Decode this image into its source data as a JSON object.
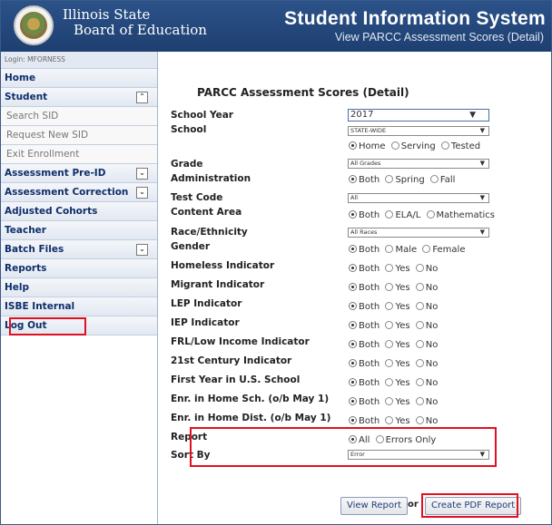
{
  "header": {
    "org_line1": "Illinois State",
    "org_line2": "Board of Education",
    "title": "Student Information System",
    "subtitle": "View PARCC Assessment Scores (Detail)"
  },
  "sidebar": {
    "login": "Login: MFORNESS",
    "items": [
      {
        "label": "Home"
      },
      {
        "label": "Student",
        "chevron": "up"
      },
      {
        "label": "Search SID"
      },
      {
        "label": "Request New SID"
      },
      {
        "label": "Exit Enrollment"
      },
      {
        "label": "Assessment Pre-ID",
        "chevron": "down"
      },
      {
        "label": "Assessment Correction",
        "chevron": "down"
      },
      {
        "label": "Adjusted Cohorts"
      },
      {
        "label": "Teacher"
      },
      {
        "label": "Batch Files",
        "chevron": "down"
      },
      {
        "label": "Reports"
      },
      {
        "label": "Help"
      },
      {
        "label": "ISBE Internal"
      },
      {
        "label": "Log Out"
      }
    ],
    "chevron_up": "⌃",
    "chevron_down": "⌄"
  },
  "main": {
    "section_title": "PARCC Assessment Scores (Detail)",
    "school_year": {
      "label": "School Year",
      "value": "2017"
    },
    "school": {
      "label": "School",
      "value": "STATE-WIDE",
      "options": [
        "Home",
        "Serving",
        "Tested"
      ],
      "selected": "Home"
    },
    "grade": {
      "label": "Grade",
      "value": "All Grades"
    },
    "administration": {
      "label": "Administration",
      "options": [
        "Both",
        "Spring",
        "Fall"
      ],
      "selected": "Both"
    },
    "test_code": {
      "label": "Test Code",
      "value": "All"
    },
    "content_area": {
      "label": "Content Area",
      "options": [
        "Both",
        "ELA/L",
        "Mathematics"
      ],
      "selected": "Both"
    },
    "race": {
      "label": "Race/Ethnicity",
      "value": "All Races"
    },
    "gender": {
      "label": "Gender",
      "options": [
        "Both",
        "Male",
        "Female"
      ],
      "selected": "Both"
    },
    "homeless": {
      "label": "Homeless Indicator",
      "options": [
        "Both",
        "Yes",
        "No"
      ],
      "selected": "Both"
    },
    "migrant": {
      "label": "Migrant Indicator",
      "options": [
        "Both",
        "Yes",
        "No"
      ],
      "selected": "Both"
    },
    "lep": {
      "label": "LEP Indicator",
      "options": [
        "Both",
        "Yes",
        "No"
      ],
      "selected": "Both"
    },
    "iep": {
      "label": "IEP Indicator",
      "options": [
        "Both",
        "Yes",
        "No"
      ],
      "selected": "Both"
    },
    "frl": {
      "label": "FRL/Low Income Indicator",
      "options": [
        "Both",
        "Yes",
        "No"
      ],
      "selected": "Both"
    },
    "century21": {
      "label": "21st Century Indicator",
      "options": [
        "Both",
        "Yes",
        "No"
      ],
      "selected": "Both"
    },
    "first_year": {
      "label": "First Year in U.S. School",
      "options": [
        "Both",
        "Yes",
        "No"
      ],
      "selected": "Both"
    },
    "home_school": {
      "label": "Enr. in Home Sch. (o/b May 1)",
      "options": [
        "Both",
        "Yes",
        "No"
      ],
      "selected": "Both"
    },
    "home_dist": {
      "label": "Enr. in Home Dist. (o/b May 1)",
      "options": [
        "Both",
        "Yes",
        "No"
      ],
      "selected": "Both"
    },
    "report": {
      "label": "Report",
      "options": [
        "All",
        "Errors Only"
      ],
      "selected": "All"
    },
    "sort_by": {
      "label": "Sort By",
      "value": "Error"
    },
    "view_report_btn": "View Report",
    "or_text": "or",
    "create_pdf_btn": "Create PDF Report"
  },
  "colors": {
    "header_bg": "#244a80",
    "highlight": "#e01020",
    "nav_text": "#0f2f6a"
  }
}
